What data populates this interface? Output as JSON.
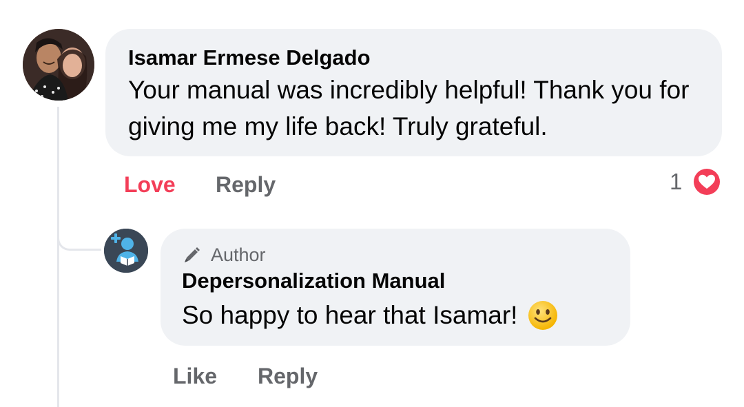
{
  "comment": {
    "author": "Isamar Ermese Delgado",
    "text": "Your manual was incredibly helpful! Thank you for giving me my life back! Truly grateful.",
    "actions": {
      "reaction_label": "Love",
      "reply_label": "Reply"
    },
    "reaction_count": "1",
    "reaction_icon": "heart-icon",
    "avatar_icon": "user-photo-avatar"
  },
  "reply": {
    "badge": "Author",
    "badge_icon": "pen-icon",
    "author": "Depersonalization Manual",
    "text": "So happy to hear that Isamar!",
    "emoji_icon": "smile-icon",
    "avatar_icon": "page-logo-avatar",
    "actions": {
      "like_label": "Like",
      "reply_label": "Reply"
    }
  },
  "colors": {
    "bubble": "#f0f2f5",
    "text": "#050505",
    "muted": "#65676b",
    "love": "#f33e58",
    "thread_line": "#e4e6eb"
  }
}
